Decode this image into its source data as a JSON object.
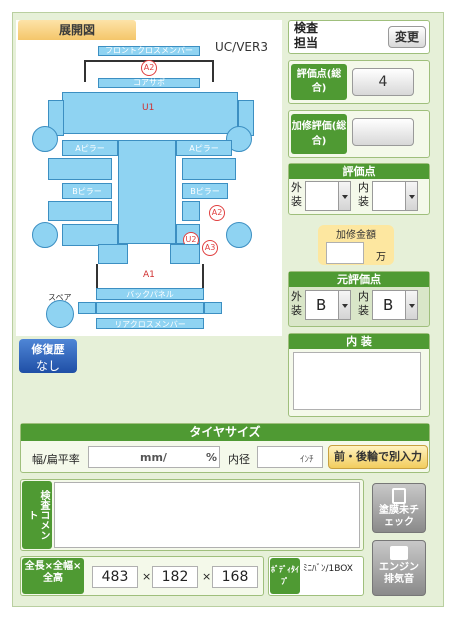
{
  "tab_title": "展開図",
  "version": "UC/VER3",
  "parts": {
    "front_cross": "フロントクロスメンバー",
    "core_support": "コアサポ",
    "a_pillar_l": "Aピラー",
    "a_pillar_r": "Aピラー",
    "b_pillar_l": "Bピラー",
    "b_pillar_r": "Bピラー",
    "back_panel": "バックパネル",
    "rear_cross": "リアクロスメンバー",
    "spare": "スペア",
    "u1": "U1",
    "a1": "A1"
  },
  "badges": {
    "a2_front": "A2",
    "a2_side": "A2",
    "u2": "U2",
    "a3": "A3"
  },
  "repair_history": {
    "label": "修復歴",
    "value": "なし"
  },
  "inspector": {
    "label": "検査担当",
    "change_button": "変更"
  },
  "score_overall": {
    "label": "評価点(総合)",
    "value": "4"
  },
  "repair_score": {
    "label": "加修評価(総合)",
    "value": ""
  },
  "score": {
    "title": "評価点",
    "exterior_label": "外装",
    "interior_label": "内装",
    "exterior_value": "",
    "interior_value": ""
  },
  "repair_cost": {
    "label": "加修金額",
    "unit": "万",
    "value": ""
  },
  "original_score": {
    "title": "元評価点",
    "exterior_label": "外装",
    "interior_label": "内装",
    "exterior_value": "B",
    "interior_value": "B"
  },
  "interior": {
    "title": "内 装",
    "value": ""
  },
  "tire": {
    "title": "タイヤサイズ",
    "width_label": "幅/扁平率",
    "mm_unit": "mm/",
    "pct_unit": "%",
    "inner_label": "内径",
    "inch_unit": "ｲﾝﾁ",
    "front_rear_button": "前・後輪で別入力",
    "width_value": "",
    "ratio_value": "",
    "inner_value": ""
  },
  "inspection_comment": {
    "label": "検査コメント",
    "value": ""
  },
  "paint_button": "塗膜未チェック",
  "engine_button": "エンジン排気音",
  "dimensions": {
    "label": "全長×全幅×全高",
    "length": "483",
    "width": "182",
    "height": "168",
    "sep1": "×",
    "sep2": "×"
  },
  "body_type": {
    "label": "ﾎﾞﾃﾞｨﾀｲﾌﾟ",
    "value": "ﾐﾆﾊﾞﾝ/1BOX"
  }
}
